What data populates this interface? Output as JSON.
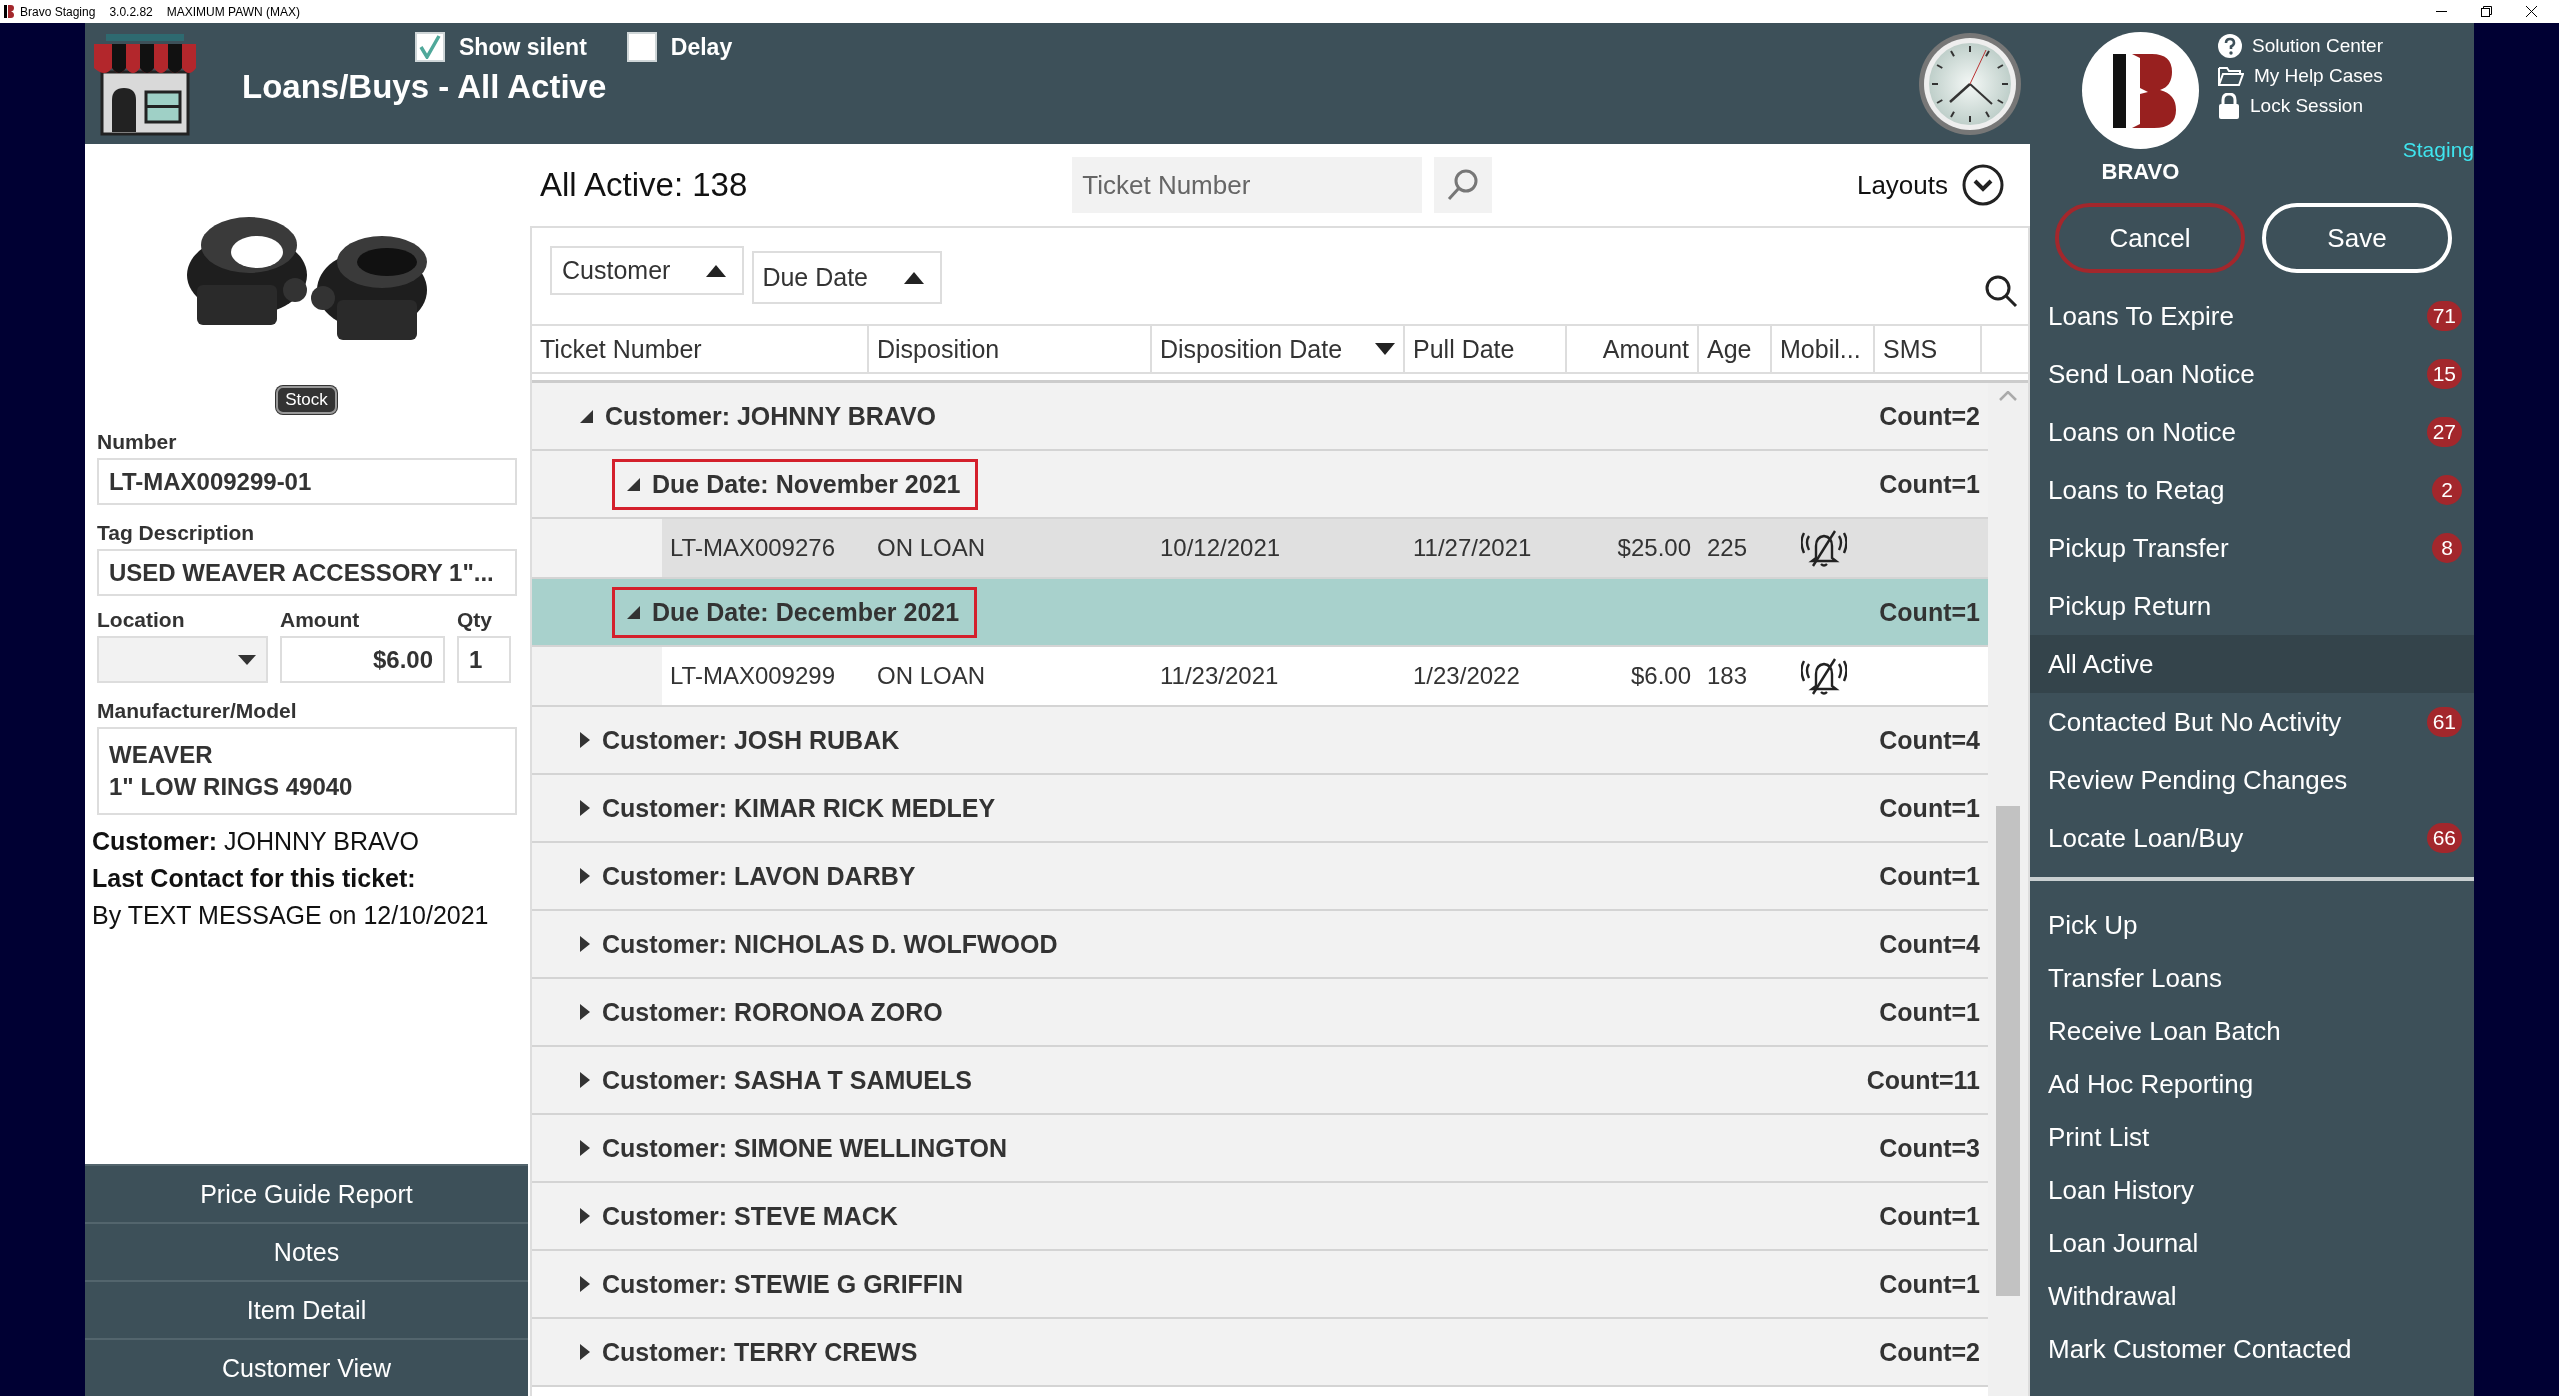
{
  "window": {
    "app_name": "Bravo Staging",
    "version": "3.0.2.82",
    "store": "MAXIMUM PAWN (MAX)"
  },
  "header": {
    "title": "Loans/Buys - All Active",
    "options": [
      {
        "label": "Show silent",
        "checked": true
      },
      {
        "label": "Delay",
        "checked": false
      }
    ]
  },
  "item_panel": {
    "stock_button": "Stock",
    "number": {
      "label": "Number",
      "value": "LT-MAX009299-01"
    },
    "tag_description": {
      "label": "Tag Description",
      "value": "USED WEAVER ACCESSORY 1\"..."
    },
    "location": {
      "label": "Location"
    },
    "amount": {
      "label": "Amount",
      "value": "$6.00"
    },
    "qty": {
      "label": "Qty",
      "value": "1"
    },
    "manufacturer_model": {
      "label": "Manufacturer/Model",
      "lines": [
        "WEAVER",
        "1\" LOW RINGS 49040"
      ]
    },
    "customer": {
      "label": "Customer:",
      "value": "JOHNNY BRAVO"
    },
    "last_contact": {
      "label": "Last Contact for this ticket:",
      "value": "By TEXT MESSAGE on 12/10/2021"
    },
    "buttons": [
      "Price Guide Report",
      "Notes",
      "Item Detail",
      "Customer View"
    ]
  },
  "list": {
    "title": "All Active: 138",
    "search": {
      "placeholder": "Ticket Number"
    },
    "layouts_label": "Layouts",
    "group_by": [
      {
        "label": "Customer",
        "ascending": true
      },
      {
        "label": "Due Date",
        "ascending": true
      }
    ],
    "columns": [
      {
        "label": "Ticket Number"
      },
      {
        "label": "Disposition"
      },
      {
        "label": "Disposition Date",
        "sorted": true,
        "ascending": false
      },
      {
        "label": "Pull Date"
      },
      {
        "label": "Amount"
      },
      {
        "label": "Age"
      },
      {
        "label": "Mobil..."
      },
      {
        "label": "SMS"
      }
    ],
    "groups": [
      {
        "label": "Customer: JOHNNY BRAVO",
        "count": "Count=2",
        "expanded": true,
        "children": [
          {
            "label": "Due Date: November 2021",
            "count": "Count=1",
            "expanded": true,
            "selected": false,
            "outlined": true,
            "rows": [
              {
                "ticket": "LT-MAX009276",
                "disposition": "ON LOAN",
                "disposition_date": "10/12/2021",
                "pull_date": "11/27/2021",
                "amount": "$25.00",
                "age": "225",
                "mobile_silenced": true,
                "highlighted": true
              }
            ]
          },
          {
            "label": "Due Date: December 2021",
            "count": "Count=1",
            "expanded": true,
            "selected": true,
            "outlined": true,
            "rows": [
              {
                "ticket": "LT-MAX009299",
                "disposition": "ON LOAN",
                "disposition_date": "11/23/2021",
                "pull_date": "1/23/2022",
                "amount": "$6.00",
                "age": "183",
                "mobile_silenced": true,
                "highlighted": false
              }
            ]
          }
        ]
      },
      {
        "label": "Customer: JOSH RUBAK",
        "count": "Count=4",
        "expanded": false
      },
      {
        "label": "Customer: KIMAR RICK MEDLEY",
        "count": "Count=1",
        "expanded": false
      },
      {
        "label": "Customer: LAVON DARBY",
        "count": "Count=1",
        "expanded": false
      },
      {
        "label": "Customer: NICHOLAS D. WOLFWOOD",
        "count": "Count=4",
        "expanded": false
      },
      {
        "label": "Customer: RORONOA ZORO",
        "count": "Count=1",
        "expanded": false
      },
      {
        "label": "Customer: SASHA T SAMUELS",
        "count": "Count=11",
        "expanded": false
      },
      {
        "label": "Customer: SIMONE WELLINGTON",
        "count": "Count=3",
        "expanded": false
      },
      {
        "label": "Customer: STEVE MACK",
        "count": "Count=1",
        "expanded": false
      },
      {
        "label": "Customer: STEWIE G GRIFFIN",
        "count": "Count=1",
        "expanded": false
      },
      {
        "label": "Customer: TERRY CREWS",
        "count": "Count=2",
        "expanded": false
      }
    ]
  },
  "sidebar": {
    "logo_text": "BRAVO",
    "links": [
      {
        "kind": "help",
        "label": "Solution Center"
      },
      {
        "kind": "folder",
        "label": "My Help Cases"
      },
      {
        "kind": "lock",
        "label": "Lock Session"
      }
    ],
    "environment": "Staging",
    "cancel": "Cancel",
    "save": "Save",
    "primary_menu": [
      {
        "label": "Loans To Expire",
        "badge": "71",
        "selected": false
      },
      {
        "label": "Send Loan Notice",
        "badge": "15",
        "selected": false
      },
      {
        "label": "Loans on Notice",
        "badge": "27",
        "selected": false
      },
      {
        "label": "Loans to Retag",
        "badge": "2",
        "selected": false
      },
      {
        "label": "Pickup Transfer",
        "badge": "8",
        "selected": false
      },
      {
        "label": "Pickup Return",
        "selected": false
      },
      {
        "label": "All Active",
        "selected": true
      },
      {
        "label": "Contacted But No Activity",
        "badge": "61",
        "selected": false
      },
      {
        "label": "Review Pending Changes",
        "selected": false
      },
      {
        "label": "Locate Loan/Buy",
        "badge": "66",
        "selected": false
      }
    ],
    "secondary_menu": [
      {
        "label": "Pick Up",
        "selected": false
      },
      {
        "label": "Transfer Loans",
        "selected": false
      },
      {
        "label": "Receive Loan Batch",
        "selected": false
      },
      {
        "label": "Ad Hoc Reporting",
        "selected": false
      },
      {
        "label": "Print List",
        "selected": false
      },
      {
        "label": "Loan History",
        "selected": false
      },
      {
        "label": "Loan Journal",
        "selected": false
      },
      {
        "label": "Withdrawal",
        "selected": false
      },
      {
        "label": "Mark Customer Contacted",
        "selected": false
      }
    ]
  }
}
